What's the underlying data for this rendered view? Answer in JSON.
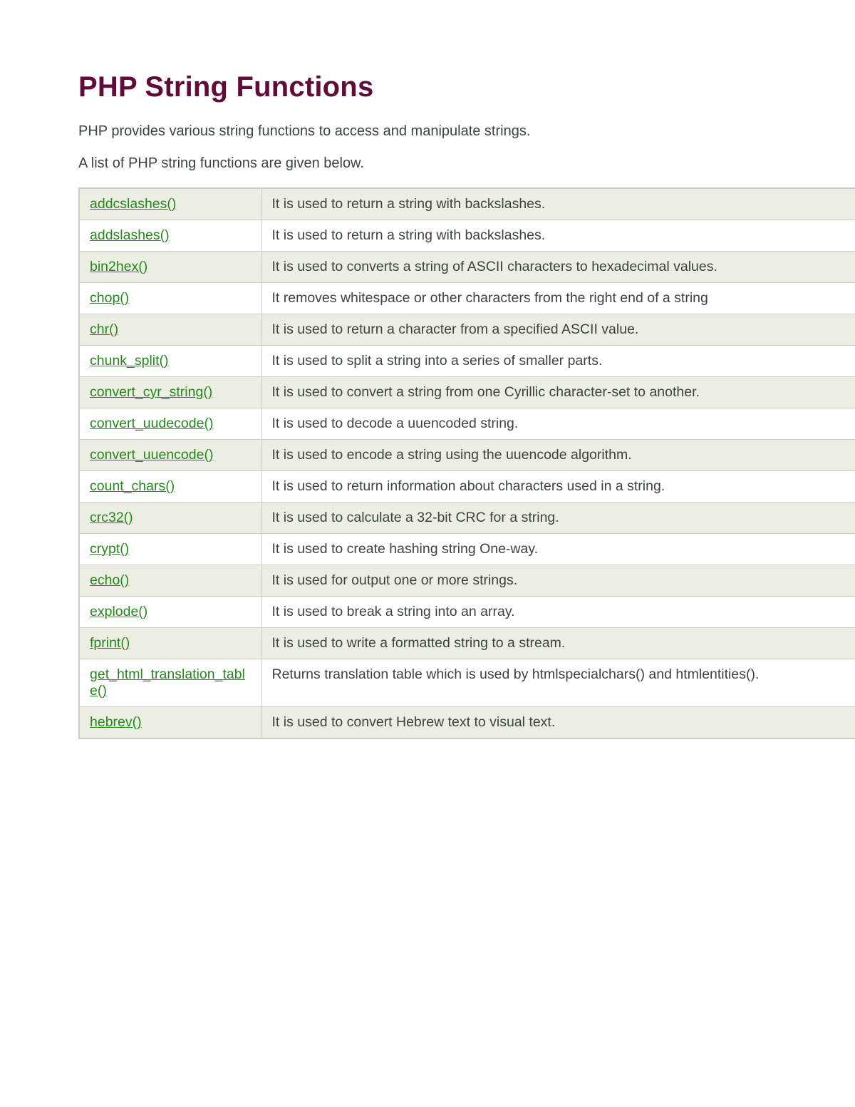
{
  "heading": "PHP String Functions",
  "intro1": "PHP provides various string functions to access and manipulate strings.",
  "intro2": "A list of PHP string functions are given below.",
  "rows": [
    {
      "fn": "addcslashes()",
      "desc": "It is used to return a string with backslashes."
    },
    {
      "fn": "addslashes()",
      "desc": "It is used to return a string with backslashes."
    },
    {
      "fn": "bin2hex()",
      "desc": "It is used to converts a string of ASCII characters to hexadecimal values."
    },
    {
      "fn": "chop()",
      "desc": "It removes whitespace or other characters from the right end of a string"
    },
    {
      "fn": "chr()",
      "desc": "It is used to return a character from a specified ASCII value."
    },
    {
      "fn": "chunk_split()",
      "desc": "It is used to split a string into a series of smaller parts."
    },
    {
      "fn": "convert_cyr_string()",
      "desc": "It is used to convert a string from one Cyrillic character-set to another."
    },
    {
      "fn": "convert_uudecode()",
      "desc": "It is used to decode a uuencoded string."
    },
    {
      "fn": "convert_uuencode()",
      "desc": "It is used to encode a string using the uuencode algorithm."
    },
    {
      "fn": "count_chars()",
      "desc": "It is used to return information about characters used in a string."
    },
    {
      "fn": "crc32()",
      "desc": "It is used to calculate a 32-bit CRC for a string."
    },
    {
      "fn": "crypt()",
      "desc": "It is used to create hashing string One-way."
    },
    {
      "fn": "echo()",
      "desc": "It is used for output one or more strings."
    },
    {
      "fn": "explode()",
      "desc": "It is used to break a string into an array."
    },
    {
      "fn": "fprint()",
      "desc": "It is used to write a formatted string to a stream."
    },
    {
      "fn": "get_html_translation_table()",
      "desc": "Returns translation table which is used by htmlspecialchars() and htmlentities()."
    },
    {
      "fn": "hebrev()",
      "desc": "It is used to convert Hebrew text to visual text."
    }
  ]
}
